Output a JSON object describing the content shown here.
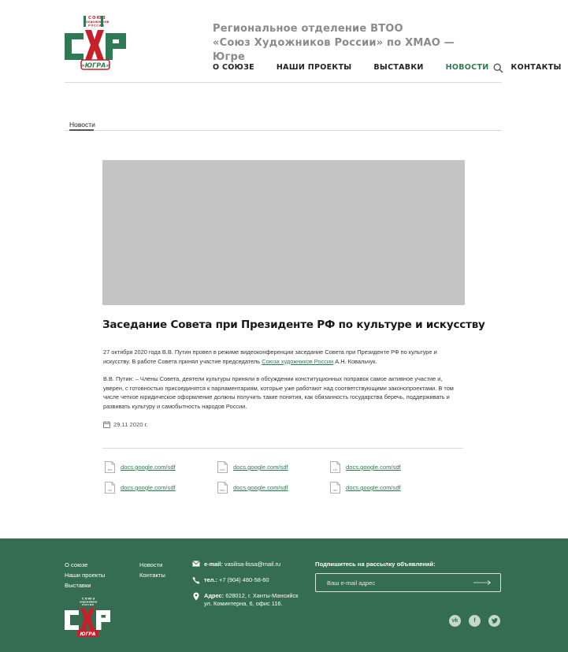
{
  "header": {
    "logo": {
      "text_top": "СОЮЗ ХУДОЖНИКОВ РОССИИ",
      "text_main": "СХР",
      "text_badge": "ЮГРА",
      "color_green": "#2f7a52",
      "color_red": "#c8202a"
    },
    "title_line1": "Региональное отделение ВТОО",
    "title_line2": "«Союз Художников России» по ХМАО — Югре",
    "nav": [
      {
        "label": "О СОЮЗЕ"
      },
      {
        "label": "НАШИ ПРОЕКТЫ"
      },
      {
        "label": "ВЫСТАВКИ"
      },
      {
        "label": "НОВОСТИ",
        "active": true
      },
      {
        "label": "КОНТАКТЫ"
      }
    ],
    "search_icon": "search-icon"
  },
  "breadcrumb": {
    "label": "Новости"
  },
  "article": {
    "title": "Заседание Совета при Президенте РФ по культуре и искусству",
    "p1_before": "27 октября 2020 года  В.В. Путин провел в режиме видеоконференции заседание Совета при Президенте РФ по культуре и искусству. В работе Совета принял участие председатель ",
    "p1_link": "Союза художников России",
    "p1_after": " А.Н. Ковальчук.",
    "p2": "В.В. Путин: – Члены Совета, деятели культуры приняли в обсуждении конституционных поправок самое активное участие и, уверен, с готовностью присоединятся к парламентариям, которые уже работают над соответствующими законопроектами. В том числе четкое юридическое оформление должны получить такие понятия, как обязанность государства беречь, поддерживать и развивать культуру и самобытность народов России.",
    "date": "29.11 2020 г.",
    "date_icon": "calendar-icon"
  },
  "documents": [
    {
      "ext": "PDF",
      "link": "docs.google.com/sdf"
    },
    {
      "ext": "DOC",
      "link": "docs.google.com/sdf"
    },
    {
      "ext": "TXT",
      "link": "docs.google.com/sdf"
    },
    {
      "ext": "XLS",
      "link": "docs.google.com/sdf"
    },
    {
      "ext": "PNG",
      "link": "docs.google.com/sdf"
    },
    {
      "ext": "ZIP",
      "link": "docs.google.com/sdf"
    }
  ],
  "footer": {
    "background": "#346d52",
    "col1": [
      "О союзе",
      "Наши проекты",
      "Выставки"
    ],
    "col2": [
      "Новости",
      "Контакты"
    ],
    "email_label": "e-mail:",
    "email_value": "vasilisa-lissa@mail.ru",
    "phone_label": "тел.:",
    "phone_value": "+7 (904) 480-58-60",
    "address_label": "Адрес:",
    "address_value": "628012, г. Ханты-Мансийск ул. Коминтерна, 6, офис 116.",
    "subscribe_label": "Подпишитесь на рассылку объявлений:",
    "subscribe_placeholder": "Ваш e-mail адрес",
    "social": [
      "vk-icon",
      "facebook-icon",
      "twitter-icon"
    ]
  }
}
